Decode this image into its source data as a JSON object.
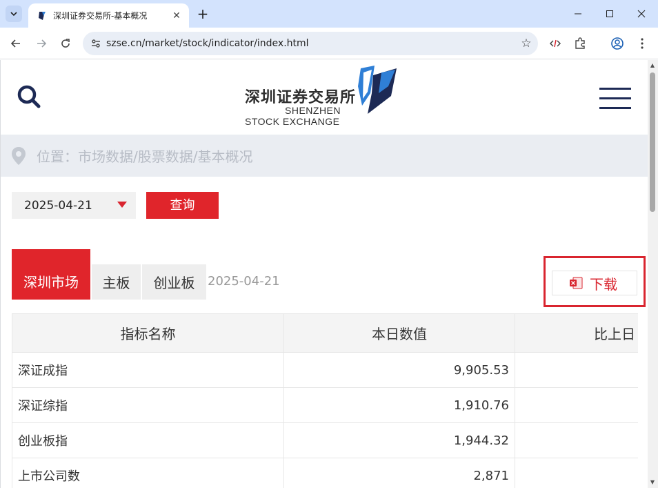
{
  "browser": {
    "tab_title": "深圳证券交易所-基本概况",
    "url": "szse.cn/market/stock/indicator/index.html"
  },
  "header": {
    "logo_cn": "深圳证券交易所",
    "logo_en_line1": "SHENZHEN",
    "logo_en_line2": "STOCK EXCHANGE"
  },
  "breadcrumb": "位置：市场数据/股票数据/基本概况",
  "filter": {
    "date": "2025-04-21",
    "query_label": "查询"
  },
  "tabs": [
    {
      "label": "深圳市场",
      "active": true
    },
    {
      "label": "主板",
      "active": false
    },
    {
      "label": "创业板",
      "active": false
    }
  ],
  "tab_date": "2025-04-21",
  "download_label": "下载",
  "table": {
    "headers": [
      "指标名称",
      "本日数值",
      "比上日"
    ],
    "rows": [
      {
        "name": "深证成指",
        "value": "9,905.53",
        "change": ""
      },
      {
        "name": "深证综指",
        "value": "1,910.76",
        "change": ""
      },
      {
        "name": "创业板指",
        "value": "1,944.32",
        "change": ""
      },
      {
        "name": "上市公司数",
        "value": "2,871",
        "change": ""
      }
    ]
  },
  "colors": {
    "accent_red": "#e0252b",
    "logo_navy": "#1d2a55",
    "logo_blue": "#2f7fd6"
  }
}
